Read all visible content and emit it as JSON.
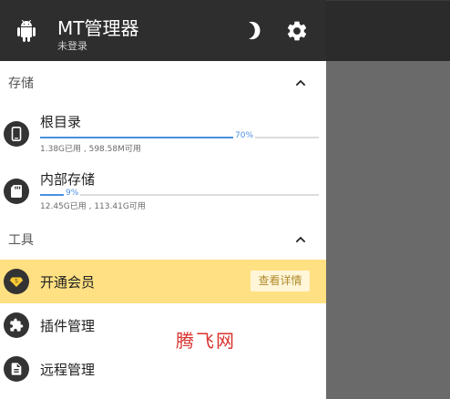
{
  "header": {
    "title": "MT管理器",
    "subtitle": "未登录",
    "icons": {
      "app": "android-icon",
      "theme": "moon-icon",
      "settings": "gear-icon"
    }
  },
  "sections": {
    "storage": {
      "label": "存储",
      "items": [
        {
          "name": "根目录",
          "percent_label": "70%",
          "percent": 70,
          "size": "1.38G已用 , 598.58M可用",
          "icon": "phone-icon"
        },
        {
          "name": "内部存储",
          "percent_label": "9%",
          "percent": 9,
          "size": "12.45G已用 , 113.41G可用",
          "icon": "sd-card-icon"
        }
      ]
    },
    "tools": {
      "label": "工具",
      "items": [
        {
          "name": "开通会员",
          "action": "查看详情",
          "icon": "vip-badge-icon"
        },
        {
          "name": "插件管理",
          "icon": "puzzle-icon"
        },
        {
          "name": "远程管理",
          "icon": "document-icon"
        }
      ]
    }
  },
  "watermark": "腾飞网",
  "colors": {
    "header_bg": "#2e2e2e",
    "accent": "#4a8fe0",
    "vip_bg": "#ffe082",
    "watermark": "#d9322e",
    "scrim": "#6a6a6a"
  }
}
